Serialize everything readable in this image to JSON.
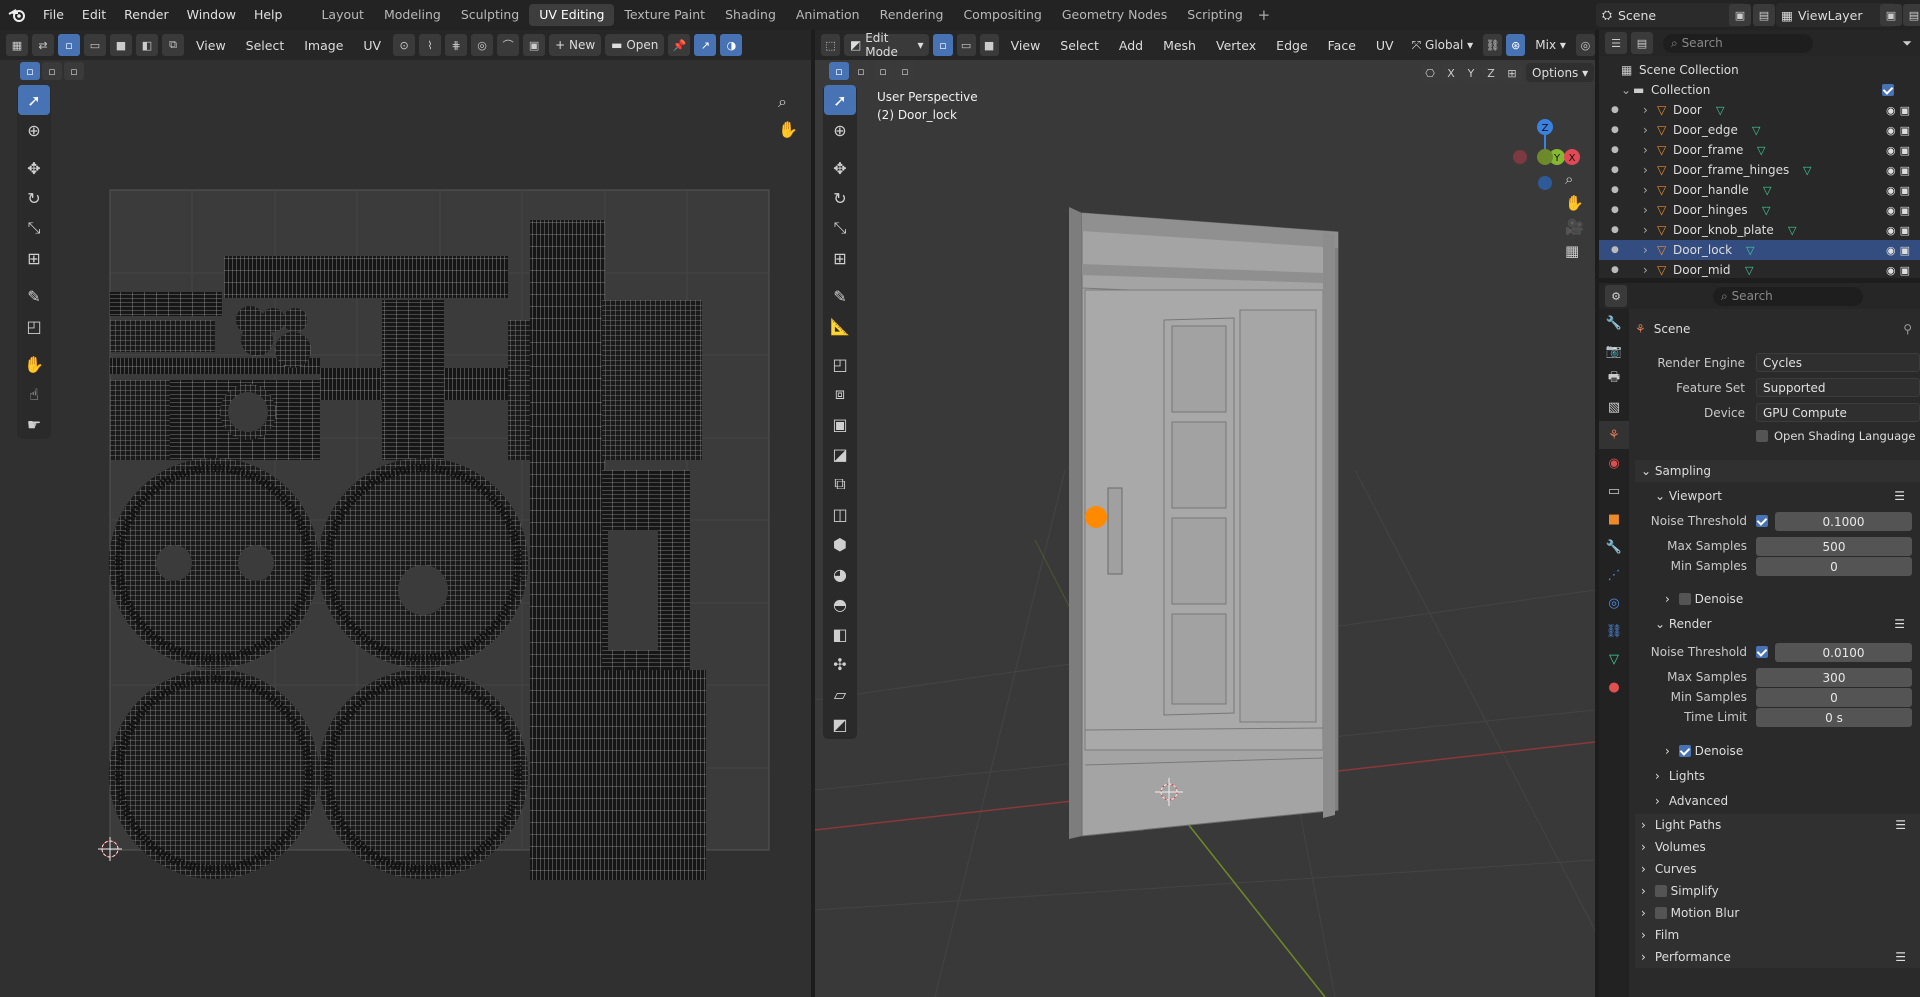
{
  "app": {
    "menus": [
      "File",
      "Edit",
      "Render",
      "Window",
      "Help"
    ],
    "workspaces": [
      "Layout",
      "Modeling",
      "Sculpting",
      "UV Editing",
      "Texture Paint",
      "Shading",
      "Animation",
      "Rendering",
      "Compositing",
      "Geometry Nodes",
      "Scripting"
    ],
    "active_workspace": "UV Editing",
    "scene": "Scene",
    "view_layer": "ViewLayer"
  },
  "uv_editor": {
    "menus": [
      "View",
      "Select",
      "Image",
      "UV"
    ],
    "new_label": "New",
    "open_label": "Open"
  },
  "viewport": {
    "mode": "Edit Mode",
    "menus": [
      "View",
      "Select",
      "Add",
      "Mesh",
      "Vertex",
      "Edge",
      "Face",
      "UV"
    ],
    "transform_orientation": "Global",
    "shading": "Mix",
    "axes": [
      "X",
      "Y",
      "Z"
    ],
    "options_label": "Options",
    "overlay_title": "User Perspective",
    "overlay_object": "(2) Door_lock",
    "gizmo": {
      "z": "Z",
      "y": "Y",
      "x": "X"
    },
    "colors": {
      "x": "#e04a55",
      "y": "#86b834",
      "z": "#3b82e0",
      "origin": "#ff8a00"
    }
  },
  "outliner": {
    "search_placeholder": "Search",
    "root": "Scene Collection",
    "collection": "Collection",
    "objects": [
      "Door",
      "Door_edge",
      "Door_frame",
      "Door_frame_hinges",
      "Door_handle",
      "Door_hinges",
      "Door_knob_plate",
      "Door_lock",
      "Door_mid"
    ],
    "selected": "Door_lock"
  },
  "properties": {
    "search_placeholder": "Search",
    "context": "Scene",
    "render_engine": {
      "label": "Render Engine",
      "value": "Cycles"
    },
    "feature_set": {
      "label": "Feature Set",
      "value": "Supported"
    },
    "device": {
      "label": "Device",
      "value": "GPU Compute"
    },
    "osl_label": "Open Shading Language",
    "sampling": "Sampling",
    "viewport_label": "Viewport",
    "viewport_noise": {
      "label": "Noise Threshold",
      "value": "0.1000"
    },
    "viewport_max": {
      "label": "Max Samples",
      "value": "500"
    },
    "viewport_min": {
      "label": "Min Samples",
      "value": "0"
    },
    "viewport_denoise": "Denoise",
    "render_label": "Render",
    "render_noise": {
      "label": "Noise Threshold",
      "value": "0.0100"
    },
    "render_max": {
      "label": "Max Samples",
      "value": "300"
    },
    "render_min": {
      "label": "Min Samples",
      "value": "0"
    },
    "time_limit": {
      "label": "Time Limit",
      "value": "0 s"
    },
    "render_denoise": "Denoise",
    "lights": "Lights",
    "advanced": "Advanced",
    "panels": [
      "Light Paths",
      "Volumes",
      "Curves",
      "Simplify",
      "Motion Blur",
      "Film",
      "Performance"
    ]
  }
}
